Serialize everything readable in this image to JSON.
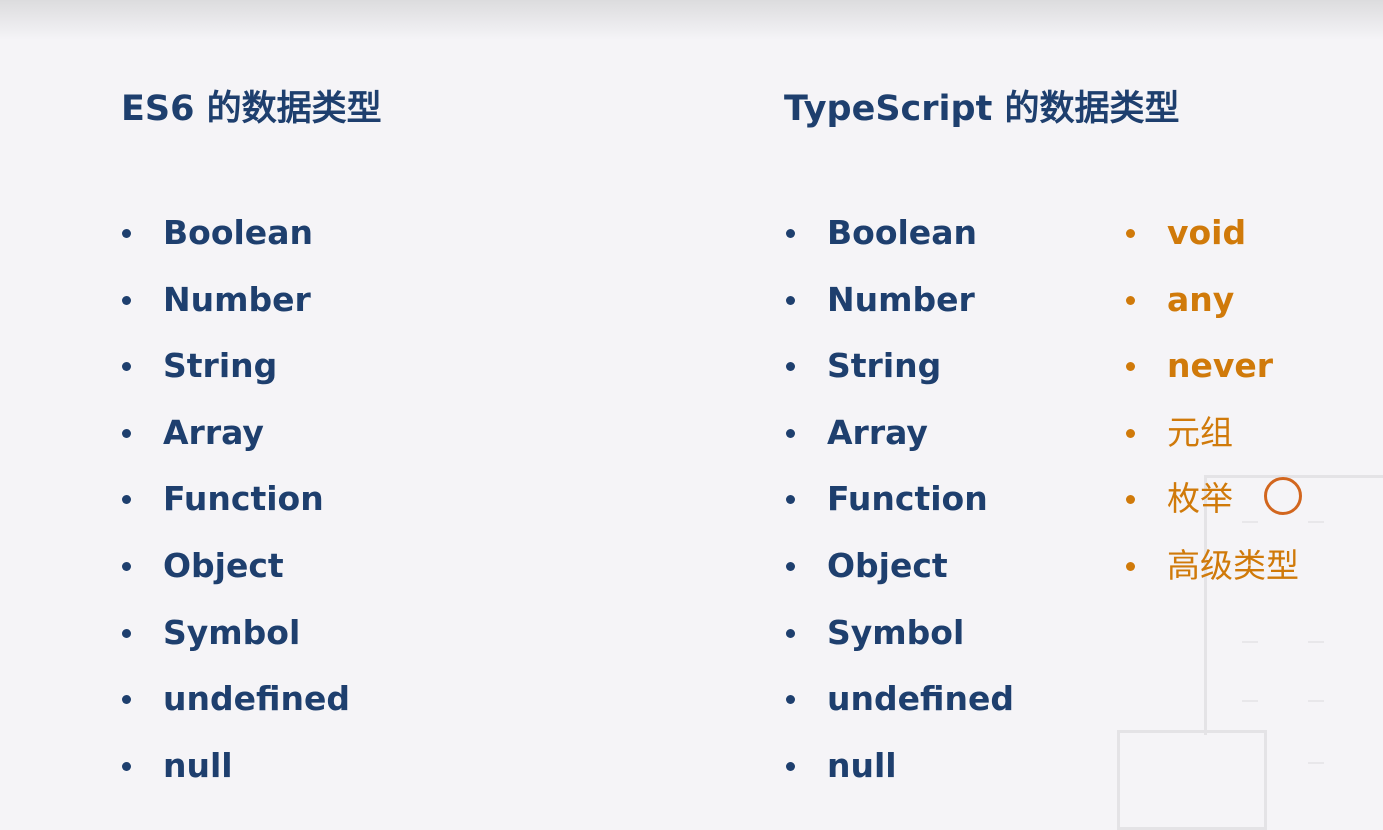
{
  "es6": {
    "title": "ES6 的数据类型",
    "items": [
      "Boolean",
      "Number",
      "String",
      "Array",
      "Function",
      "Object",
      "Symbol",
      "undefined",
      "null"
    ]
  },
  "typescript": {
    "title": "TypeScript 的数据类型",
    "items": [
      "Boolean",
      "Number",
      "String",
      "Array",
      "Function",
      "Object",
      "Symbol",
      "undefined",
      "null"
    ],
    "extra_items": [
      "void",
      "any",
      "never",
      "元组",
      "枚举",
      "高级类型"
    ]
  },
  "colors": {
    "text": "#1e3f6e",
    "accent": "#d07a0a",
    "cursor": "#d2661e"
  }
}
